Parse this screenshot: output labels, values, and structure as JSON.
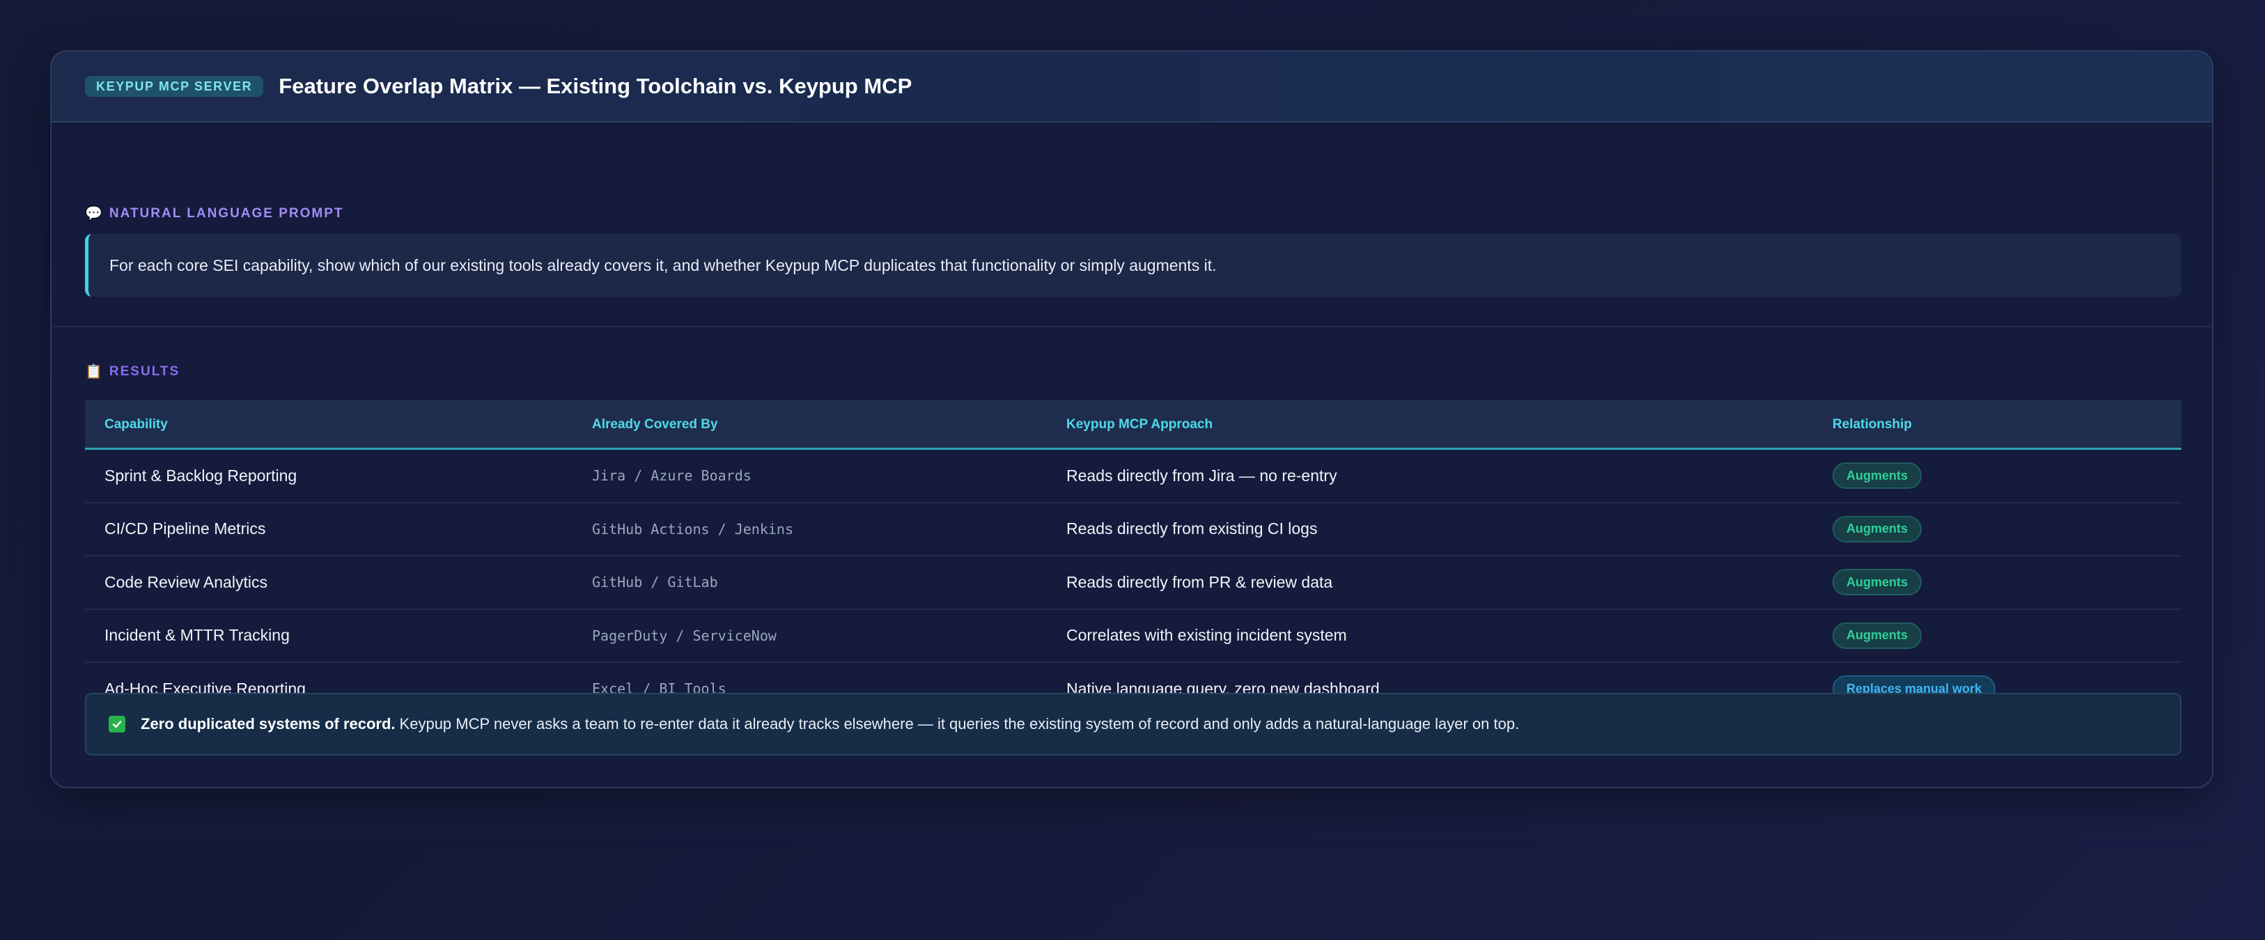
{
  "header": {
    "badge": "KEYPUP MCP SERVER",
    "title": "Feature Overlap Matrix — Existing Toolchain vs. Keypup MCP"
  },
  "prompt": {
    "icon": "speech-bubble-icon",
    "label": "NATURAL LANGUAGE PROMPT",
    "text": "For each core SEI capability, show which of our existing tools already covers it, and whether Keypup MCP duplicates that functionality or simply augments it."
  },
  "results": {
    "icon": "clipboard-icon",
    "label": "RESULTS"
  },
  "table": {
    "columns": [
      "Capability",
      "Already Covered By",
      "Keypup MCP Approach",
      "Relationship"
    ],
    "rows": [
      {
        "capability": "Sprint & Backlog Reporting",
        "covered_by": "Jira / Azure Boards",
        "approach": "Reads directly from Jira — no re-entry",
        "relationship": "Augments",
        "type": "augments"
      },
      {
        "capability": "CI/CD Pipeline Metrics",
        "covered_by": "GitHub Actions / Jenkins",
        "approach": "Reads directly from existing CI logs",
        "relationship": "Augments",
        "type": "augments"
      },
      {
        "capability": "Code Review Analytics",
        "covered_by": "GitHub / GitLab",
        "approach": "Reads directly from PR & review data",
        "relationship": "Augments",
        "type": "augments"
      },
      {
        "capability": "Incident & MTTR Tracking",
        "covered_by": "PagerDuty / ServiceNow",
        "approach": "Correlates with existing incident system",
        "relationship": "Augments",
        "type": "augments"
      },
      {
        "capability": "Ad-Hoc Executive Reporting",
        "covered_by": "Excel / BI Tools",
        "approach": "Native language query, zero new dashboard",
        "relationship": "Replaces manual work",
        "type": "replaces"
      }
    ]
  },
  "footer": {
    "icon": "check-box-icon",
    "strong": "Zero duplicated systems of record.",
    "text": "Keypup MCP never asks a team to re-enter data it already tracks elsewhere — it queries the existing system of record and only adds a natural-language layer on top."
  },
  "colors": {
    "accent_cyan": "#4fd9ea",
    "augments": "#2fd09a",
    "replaces": "#3fb6ef",
    "prompt_label": "#a08cf5"
  }
}
